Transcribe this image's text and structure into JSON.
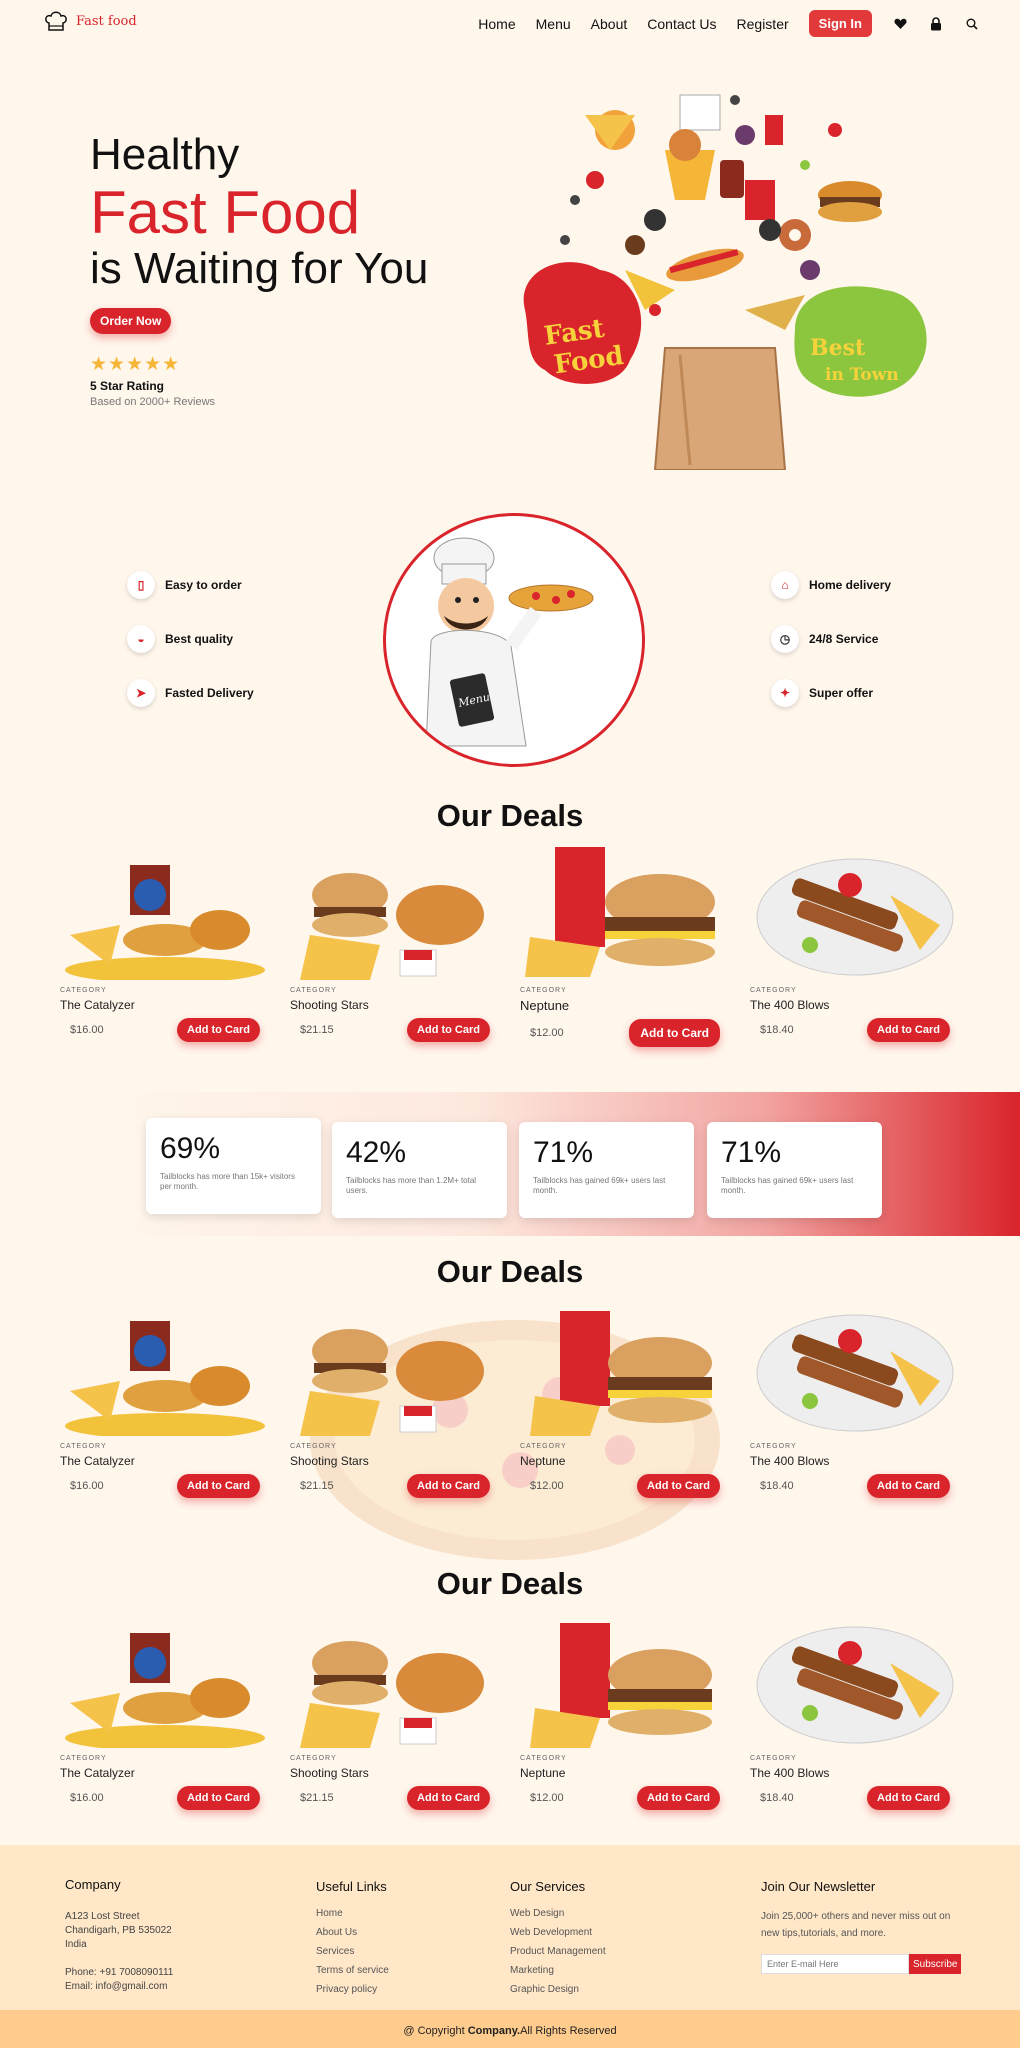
{
  "nav": {
    "brand": "Fast food",
    "items": [
      "Home",
      "Menu",
      "About",
      "Contact Us",
      "Register"
    ],
    "signin": "Sign In",
    "icons": [
      "heart-icon",
      "lock-icon",
      "search-icon"
    ]
  },
  "hero": {
    "line1": "Healthy",
    "line2": "Fast Food",
    "line3": "is Waiting for You",
    "cta": "Order Now",
    "stars": "★★★★★",
    "rating_title": "5 Star Rating",
    "rating_sub": "Based on 2000+ Reviews",
    "badge_left": "Fast Food",
    "badge_right": "Best in Town"
  },
  "features": {
    "left": [
      "Easy to order",
      "Best quality",
      "Fasted Delivery"
    ],
    "right": [
      "Home delivery",
      "24/8 Service",
      "Super offer"
    ],
    "chef_menu_text": "Menu"
  },
  "deals": {
    "title": "Our Deals",
    "category_label": "CATEGORY",
    "button_label": "Add to Card",
    "items": [
      {
        "name": "The Catalyzer",
        "price": "$16.00"
      },
      {
        "name": "Shooting Stars",
        "price": "$21.15"
      },
      {
        "name": "Neptune",
        "price": "$12.00"
      },
      {
        "name": "The 400 Blows",
        "price": "$18.40"
      }
    ]
  },
  "stats": [
    {
      "value": "69%",
      "desc": "Tailblocks has more than 15k+ visitors per month."
    },
    {
      "value": "42%",
      "desc": "Tailblocks has more than 1.2M+ total users."
    },
    {
      "value": "71%",
      "desc": "Tailblocks has gained 69k+ users last month."
    },
    {
      "value": "71%",
      "desc": "Tailblocks has gained 69k+ users last month."
    }
  ],
  "footer": {
    "company_title": "Company",
    "address": [
      "A123 Lost Street",
      "Chandigarh, PB 535022",
      "India"
    ],
    "phone": "Phone: +91 7008090111",
    "email": "Email: info@gmail.com",
    "links_title": "Useful Links",
    "links": [
      "Home",
      "About Us",
      "Services",
      "Terms of service",
      "Privacy policy"
    ],
    "services_title": "Our Services",
    "services": [
      "Web Design",
      "Web Development",
      "Product Management",
      "Marketing",
      "Graphic Design"
    ],
    "newsletter_title": "Join Our Newsletter",
    "newsletter_text": "Join 25,000+ others and never miss out on new tips,tutorials, and more.",
    "newsletter_placeholder": "Enter E-mail Here",
    "newsletter_button": "Subscribe",
    "copyright_pre": "@ Copyright ",
    "copyright_brand": "Company.",
    "copyright_post": "All Rights Reserved"
  },
  "colors": {
    "accent": "#d9242b",
    "background": "#fff6ec",
    "star": "#f5b638",
    "footer": "#ffe7c8",
    "copy_bar": "#ffcc8e"
  }
}
